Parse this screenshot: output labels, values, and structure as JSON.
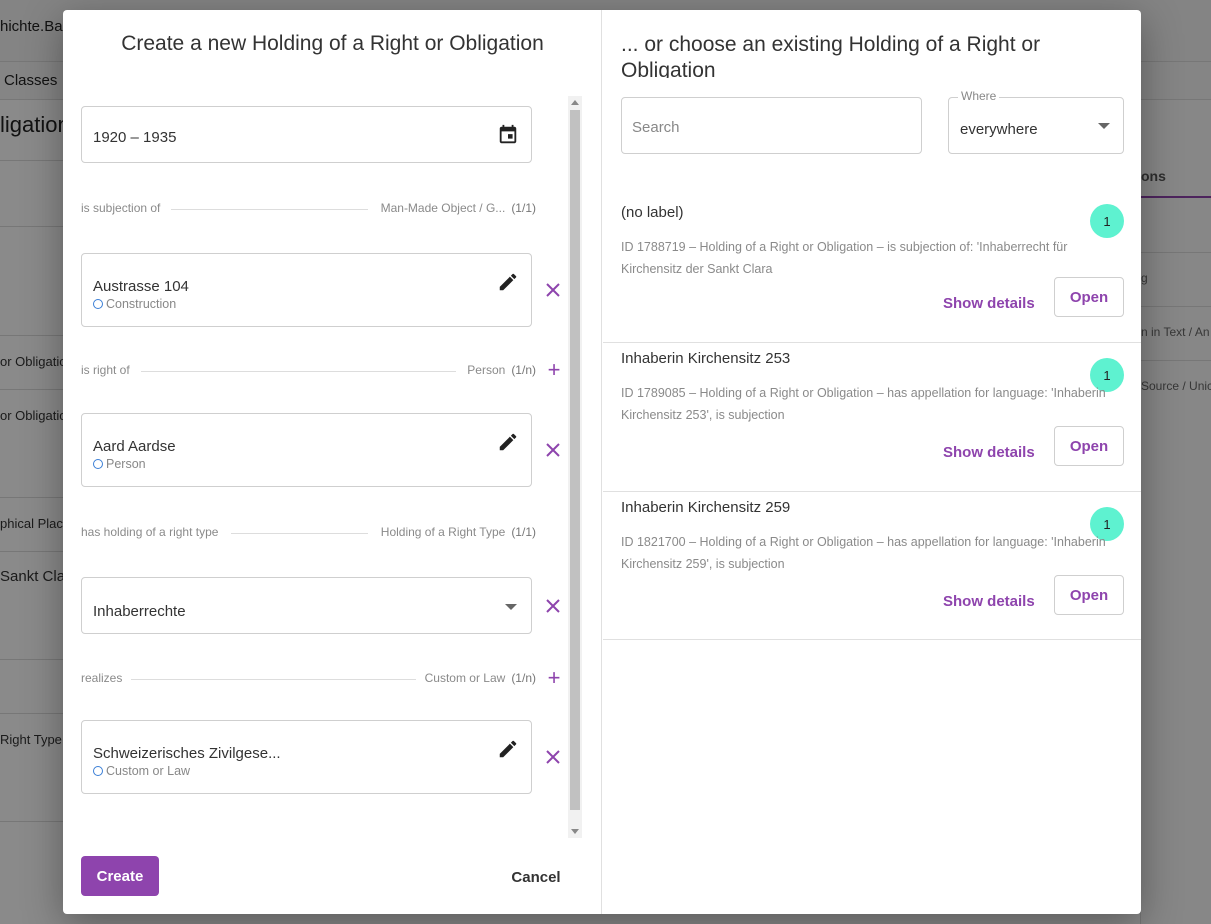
{
  "background": {
    "title_fragment": "hichte.Bas",
    "nav_classes": "Classes",
    "heading_fragment": "ligation",
    "left_rows": [
      "or Obligatio",
      "or Obligatio",
      "phical Place",
      "Sankt Clar",
      "Right Type"
    ],
    "right_tab": "ons",
    "right_rows": [
      "g",
      "n in Text / An",
      "Source / Unic"
    ]
  },
  "left_pane": {
    "title": "Create a new Holding of a Right or Obligation",
    "timespan": {
      "value": "1920 – 1935",
      "icon": "calendar-icon"
    },
    "relations": [
      {
        "label": "is subjection of",
        "target": "Man-Made Object / G...",
        "count": "(1/1)"
      },
      {
        "label": "is right of",
        "target": "Person",
        "count": "(1/n)"
      },
      {
        "label": "has holding of a right type",
        "target": "Holding of a Right Type",
        "count": "(1/1)"
      },
      {
        "label": "realizes",
        "target": "Custom or Law",
        "count": "(1/n)"
      }
    ],
    "subjection_item": {
      "name": "Austrasse 104",
      "class": "Construction"
    },
    "person_item": {
      "name": "Aard Aardse",
      "class": "Person"
    },
    "type_select": {
      "value": "Inhaberrechte"
    },
    "law_item": {
      "name": "Schweizerisches Zivilgese...",
      "class": "Custom or Law"
    },
    "create_label": "Create",
    "cancel_label": "Cancel"
  },
  "right_pane": {
    "title": "... or choose an existing Holding of a Right or Obligation",
    "search": {
      "placeholder": "Search",
      "value": ""
    },
    "where": {
      "label": "Where",
      "value": "everywhere"
    },
    "results": [
      {
        "title": "(no label)",
        "count": "1",
        "description": "ID 1788719 – Holding of a Right or Obligation – is subjection of: 'Inhaberrecht für Kirchensitz der Sankt Clara",
        "details_label": "Show details",
        "open_label": "Open"
      },
      {
        "title": "Inhaberin Kirchensitz 253",
        "count": "1",
        "description": "ID 1789085 – Holding of a Right or Obligation – has appellation for language: 'Inhaberin Kirchensitz 253', is subjection",
        "details_label": "Show details",
        "open_label": "Open"
      },
      {
        "title": "Inhaberin Kirchensitz 259",
        "count": "1",
        "description": "ID 1821700 – Holding of a Right or Obligation – has appellation for language: 'Inhaberin Kirchensitz 259', is subjection",
        "details_label": "Show details",
        "open_label": "Open"
      }
    ]
  },
  "colors": {
    "accent": "#8e44ad",
    "badge": "#5ef2d0",
    "class_icon": "#3b7fd6"
  }
}
